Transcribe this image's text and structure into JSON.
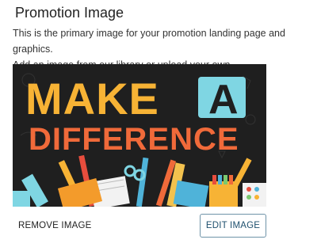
{
  "section": {
    "title": "Promotion Image",
    "description_line1": "This is the primary image for your promotion landing page and graphics.",
    "description_line2": "Add an image from our library or upload your own."
  },
  "image": {
    "headline_word1": "MAKE",
    "headline_word2": "A",
    "headline_word3": "DIFFERENCE",
    "colors": {
      "background": "#1f1f1f",
      "make": "#f7b335",
      "a_box": "#7fd6e3",
      "difference": "#f06a3a"
    }
  },
  "actions": {
    "remove_label": "REMOVE IMAGE",
    "edit_label": "EDIT IMAGE"
  }
}
